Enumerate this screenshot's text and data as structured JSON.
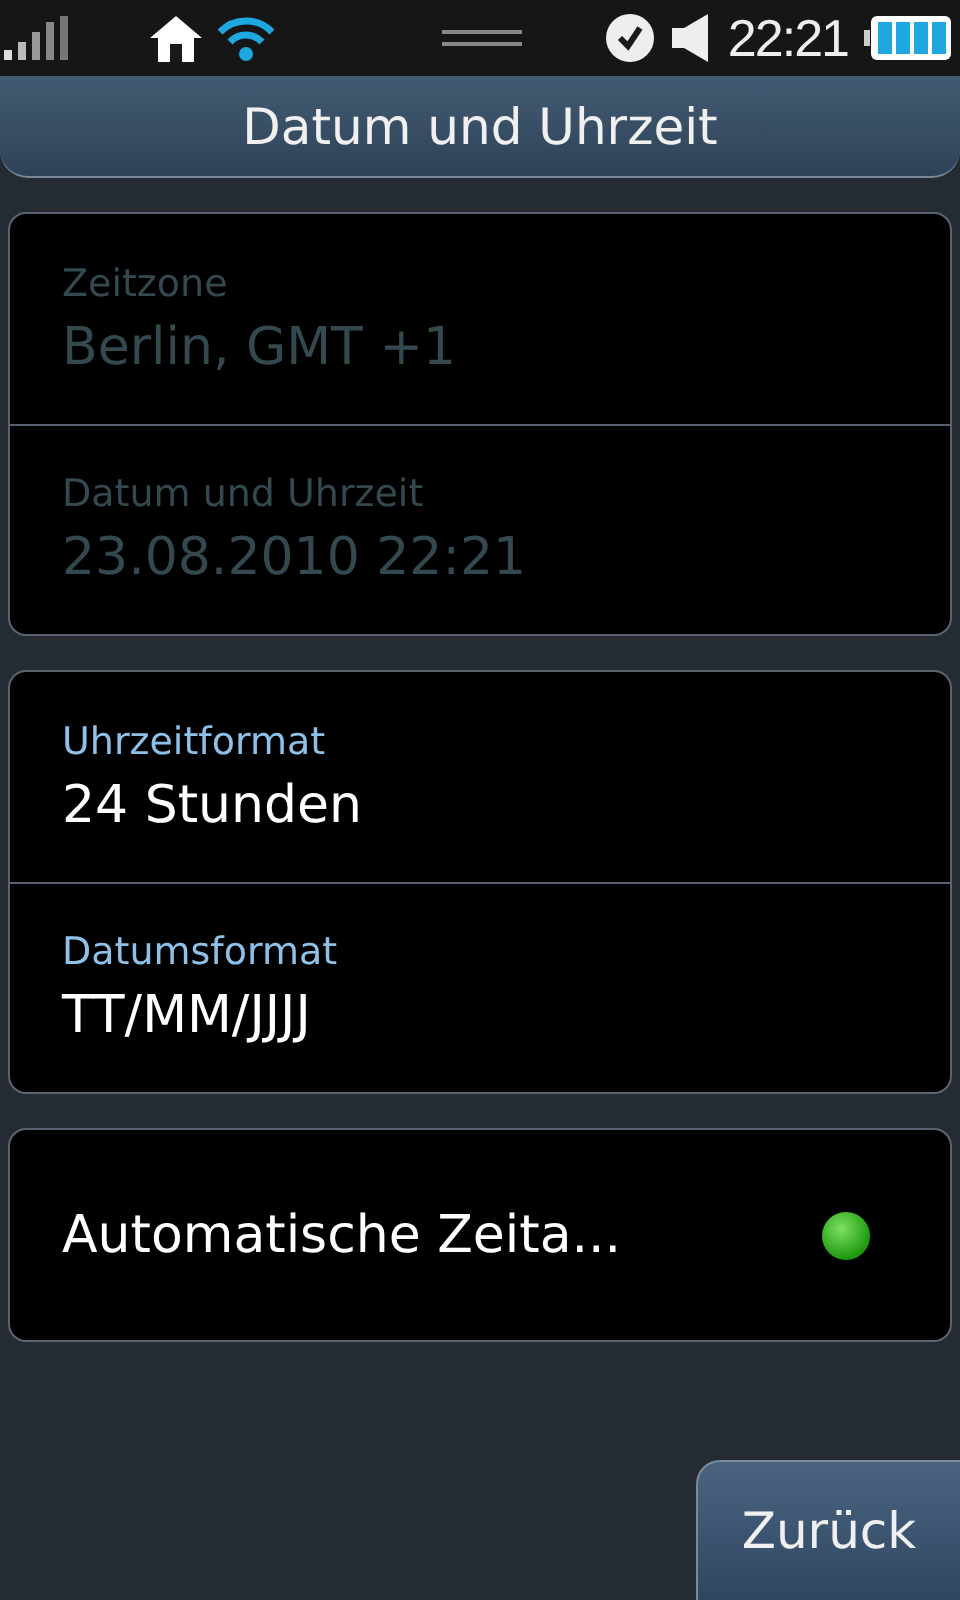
{
  "status_bar": {
    "time": "22:21"
  },
  "header": {
    "title": "Datum und Uhrzeit"
  },
  "groups": [
    {
      "items": [
        {
          "kind": "value",
          "label": "Zeitzone",
          "value": "Berlin, GMT +1",
          "disabled": true
        },
        {
          "kind": "value",
          "label": "Datum und Uhrzeit",
          "value": "23.08.2010 22:21",
          "disabled": true
        }
      ]
    },
    {
      "items": [
        {
          "kind": "value",
          "label": "Uhrzeitformat",
          "value": "24 Stunden",
          "disabled": false
        },
        {
          "kind": "value",
          "label": "Datumsformat",
          "value": "TT/MM/JJJJ",
          "disabled": false
        }
      ]
    },
    {
      "items": [
        {
          "kind": "toggle",
          "label": "Automatische Zeita...",
          "on": true
        }
      ]
    }
  ],
  "back_button": {
    "label": "Zurück"
  }
}
